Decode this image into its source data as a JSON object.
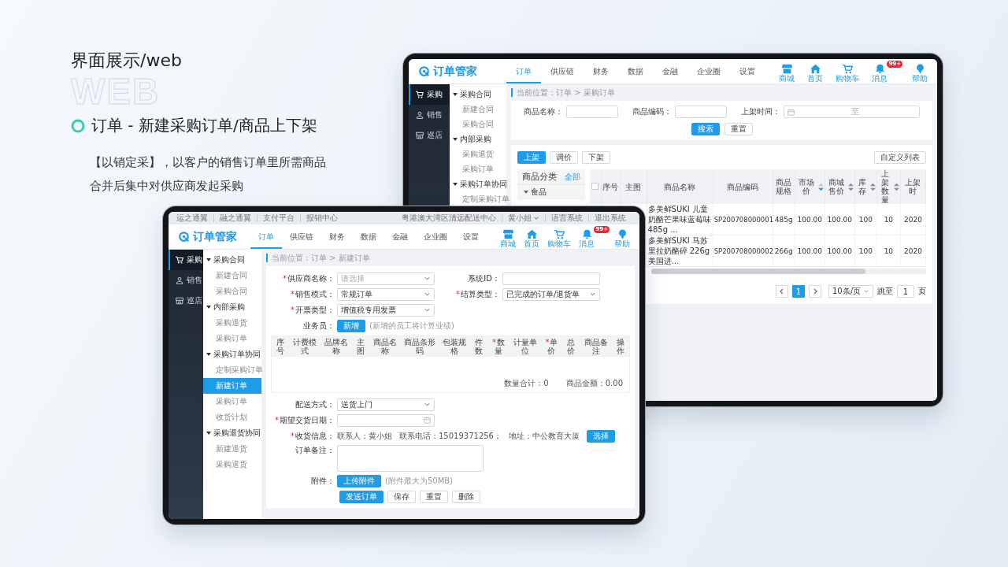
{
  "intro": {
    "background_word": "WEB",
    "title": "界面展示/web",
    "subtitle": "订单 - 新建采购订单/商品上下架",
    "description": "【以销定采】，以客户的销售订单里所需商品合并后集中对供应商发起采购"
  },
  "back_screen": {
    "logo": "订单管家",
    "nav": [
      {
        "label": "订单",
        "selected": true
      },
      {
        "label": "供应链",
        "selected": false
      },
      {
        "label": "财务",
        "selected": false
      },
      {
        "label": "数据",
        "selected": false
      },
      {
        "label": "金融",
        "selected": false
      },
      {
        "label": "企业圈",
        "selected": false
      },
      {
        "label": "设置",
        "selected": false
      }
    ],
    "shortcuts": [
      {
        "kind": "shop",
        "label": "商城"
      },
      {
        "kind": "home",
        "label": "首页"
      },
      {
        "kind": "cart",
        "label": "购物车"
      },
      {
        "kind": "bell",
        "label": "消息",
        "badge": "99+"
      },
      {
        "kind": "help",
        "label": "帮助"
      }
    ],
    "sidebar": [
      {
        "kind": "cart",
        "label": "采购",
        "selected": true
      },
      {
        "kind": "user",
        "label": "销售",
        "selected": false
      },
      {
        "kind": "store",
        "label": "巡店",
        "selected": false
      }
    ],
    "submenu": [
      {
        "label": "采购合同",
        "expanded": true,
        "children": [
          {
            "label": "新建合同",
            "selected": false
          },
          {
            "label": "采购合同",
            "selected": false
          }
        ]
      },
      {
        "label": "内部采购",
        "expanded": true,
        "children": [
          {
            "label": "采购退货",
            "selected": false
          },
          {
            "label": "采购订单",
            "selected": false
          }
        ]
      },
      {
        "label": "采购订单协同",
        "expanded": true,
        "children": [
          {
            "label": "定制采购订单",
            "selected": false
          }
        ]
      }
    ],
    "breadcrumb": "当前位置：订单 > 采购订单",
    "content": {
      "kind": "product_list",
      "filters": [
        {
          "kind": "text",
          "label": "商品名称："
        },
        {
          "kind": "text",
          "label": "商品编码："
        },
        {
          "kind": "daterange",
          "label": "上架时间：",
          "separator": "至"
        }
      ],
      "filter_buttons": [
        {
          "label": "搜索",
          "kind": "primary"
        },
        {
          "label": "重置",
          "kind": "default"
        }
      ],
      "actions": [
        {
          "label": "上架",
          "kind": "primary"
        },
        {
          "label": "调价",
          "kind": "default"
        },
        {
          "label": "下架",
          "kind": "default"
        }
      ],
      "custom_list_button": "自定义列表",
      "category_panel": {
        "title": "商品分类",
        "all_link": "全部",
        "items": [
          {
            "label": "食品",
            "expanded": true
          }
        ]
      },
      "table": {
        "select_all_checked": false,
        "columns": [
          {
            "label": "序号",
            "sortable": false
          },
          {
            "label": "主图",
            "sortable": false
          },
          {
            "label": "商品名称",
            "sortable": false
          },
          {
            "label": "商品编码",
            "sortable": false
          },
          {
            "label": "商品规格",
            "sortable": false
          },
          {
            "label": "市场价",
            "sortable": true,
            "sort_active": true
          },
          {
            "label": "商城售价",
            "sortable": true,
            "sort_active": false
          },
          {
            "label": "库存",
            "sortable": true,
            "sort_active": false
          },
          {
            "label": "上架数量",
            "sortable": true,
            "sort_active": false
          },
          {
            "label": "上架时",
            "sortable": false
          }
        ],
        "rows": [
          {
            "cells": [
              "",
              "",
              "多美鲜SUKI 儿童奶酪芒果味蓝莓味 485g ...",
              "SP200708000001",
              "485g",
              "100.00",
              "100.00",
              "100",
              "10",
              "2020"
            ]
          },
          {
            "cells": [
              "",
              "",
              "多美鲜SUKI 马苏里拉奶酪碎 226g 美国进...",
              "SP200708000002",
              "266g",
              "100.00",
              "100.00",
              "100",
              "10",
              "2020"
            ]
          }
        ]
      },
      "pagination": {
        "pages": [
          {
            "label": "1",
            "selected": true
          }
        ],
        "page_size": "10条/页",
        "jump_label": "跳至",
        "jump_value": "1",
        "page_suffix": "页"
      }
    }
  },
  "front_screen": {
    "top_links": [
      "运之通翼",
      "融之通翼",
      "支付平台",
      "报销中心"
    ],
    "location": "粤港澳大湾区清远配送中心",
    "user": "黄小姐",
    "top_right_links": [
      "语言系统",
      "退出系统"
    ],
    "logo": "订单管家",
    "nav": [
      {
        "label": "订单",
        "selected": true
      },
      {
        "label": "供应链",
        "selected": false
      },
      {
        "label": "财务",
        "selected": false
      },
      {
        "label": "数据",
        "selected": false
      },
      {
        "label": "金融",
        "selected": false
      },
      {
        "label": "企业圈",
        "selected": false
      },
      {
        "label": "设置",
        "selected": false
      }
    ],
    "shortcuts": [
      {
        "kind": "shop",
        "label": "商城"
      },
      {
        "kind": "home",
        "label": "首页"
      },
      {
        "kind": "cart",
        "label": "购物车"
      },
      {
        "kind": "bell",
        "label": "消息",
        "badge": "99+"
      },
      {
        "kind": "help",
        "label": "帮助"
      }
    ],
    "sidebar": [
      {
        "kind": "cart",
        "label": "采购",
        "selected": true
      },
      {
        "kind": "user",
        "label": "销售",
        "selected": false
      },
      {
        "kind": "store",
        "label": "巡店",
        "selected": false
      }
    ],
    "submenu": [
      {
        "label": "采购合同",
        "expanded": true,
        "children": [
          {
            "label": "新建合同",
            "selected": false
          },
          {
            "label": "采购合同",
            "selected": false
          }
        ]
      },
      {
        "label": "内部采购",
        "expanded": true,
        "children": [
          {
            "label": "采购退货",
            "selected": false
          },
          {
            "label": "采购订单",
            "selected": false
          }
        ]
      },
      {
        "label": "采购订单协同",
        "expanded": true,
        "children": [
          {
            "label": "定制采购订单",
            "selected": false
          },
          {
            "label": "新建订单",
            "selected": true
          },
          {
            "label": "采购订单",
            "selected": false
          },
          {
            "label": "收货计划",
            "selected": false
          }
        ]
      },
      {
        "label": "采购退货协同",
        "expanded": true,
        "children": [
          {
            "label": "新建退货",
            "selected": false
          },
          {
            "label": "采购退货",
            "selected": false
          }
        ]
      }
    ],
    "breadcrumb": "当前位置：订单 > 新建订单",
    "content": {
      "kind": "order_form",
      "required_mark": "*",
      "top_rows": [
        [
          {
            "kind": "select",
            "label": "供应商名称：",
            "required": true,
            "placeholder": "请选择"
          },
          {
            "kind": "text",
            "label": "系统ID：",
            "required": false
          }
        ],
        [
          {
            "kind": "select",
            "label": "销售模式：",
            "required": true,
            "value": "常规订单"
          },
          {
            "kind": "select",
            "label": "结算类型：",
            "required": true,
            "value": "已完成的订单/退货单"
          }
        ],
        [
          {
            "kind": "select",
            "label": "开票类型：",
            "required": true,
            "value": "增值税专用发票"
          }
        ],
        [
          {
            "kind": "add",
            "label": "业务员：",
            "required": false,
            "button": "新增",
            "note": "(新增的员工将计算业绩)"
          }
        ]
      ],
      "items_table": {
        "columns": [
          {
            "label": "序号",
            "required": false
          },
          {
            "label": "计费模式",
            "required": false
          },
          {
            "label": "品牌名称",
            "required": false
          },
          {
            "label": "主图",
            "required": false
          },
          {
            "label": "商品名称",
            "required": false
          },
          {
            "label": "商品条形码",
            "required": false
          },
          {
            "label": "包装规格",
            "required": false
          },
          {
            "label": "件数",
            "required": false
          },
          {
            "label": "数量",
            "required": true
          },
          {
            "label": "计量单位",
            "required": false
          },
          {
            "label": "单价",
            "required": true
          },
          {
            "label": "总价",
            "required": false
          },
          {
            "label": "商品备注",
            "required": false
          },
          {
            "label": "操作",
            "required": false
          }
        ],
        "totals": [
          "数量合计：0",
          "商品金额：0.00"
        ]
      },
      "bottom_rows": [
        [
          {
            "kind": "select",
            "label": "配送方式：",
            "required": false,
            "value": "送货上门"
          }
        ],
        [
          {
            "kind": "date",
            "label": "期望交货日期：",
            "required": true
          }
        ],
        [
          {
            "kind": "contact",
            "label": "收货信息：",
            "required": true,
            "parts": [
              "联系人：黄小姐",
              "联系电话：15019371256；",
              "地址：中公教育大厦"
            ],
            "button": "选择"
          }
        ],
        [
          {
            "kind": "textarea",
            "label": "订单备注：",
            "required": false
          }
        ],
        [
          {
            "kind": "upload",
            "label": "附件：",
            "required": false,
            "button": "上传附件",
            "note": "(附件最大为50MB)"
          }
        ]
      ],
      "buttons": [
        {
          "label": "发送订单",
          "kind": "primary"
        },
        {
          "label": "保存",
          "kind": "default"
        },
        {
          "label": "重置",
          "kind": "default"
        },
        {
          "label": "删除",
          "kind": "default"
        }
      ]
    }
  }
}
